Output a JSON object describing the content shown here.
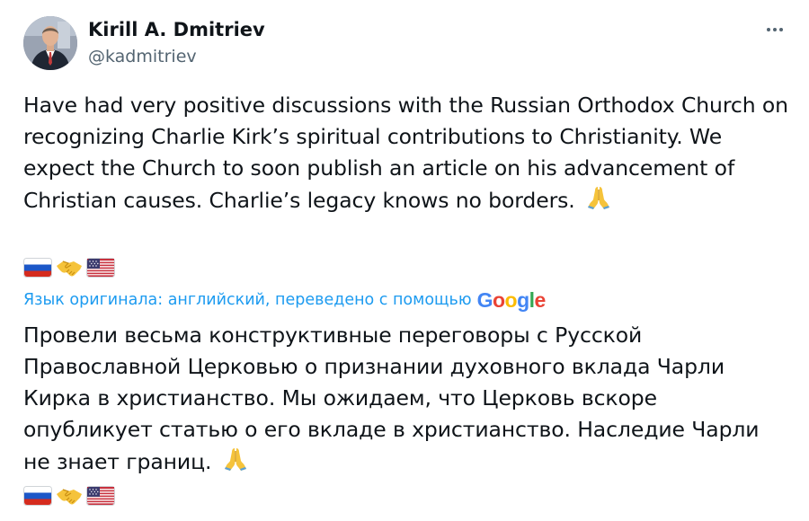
{
  "author": {
    "name": "Kirill A. Dmitriev",
    "handle": "@kadmitriev"
  },
  "tweet": {
    "text": "Have had very positive discussions with the Russian Orthodox Church on recognizing Charlie Kirk’s spiritual contributions to Christianity. We expect the Church to soon publish an article on his advancement of Christian causes. Charlie’s legacy knows no borders.",
    "trailing_emoji_icon": "folded-hands-icon",
    "flag_icons": [
      "russia-flag-icon",
      "handshake-icon",
      "usa-flag-icon"
    ]
  },
  "translation": {
    "note": "Язык оригинала: английский, переведено с помощью",
    "provider": {
      "letters": [
        "G",
        "o",
        "o",
        "g",
        "l",
        "e"
      ]
    },
    "text": "Провели весьма конструктивные переговоры с Русской Православной Церковью о признании духовного вклада Чарли Кирка в христианство. Мы ожидаем, что Церковь вскоре опубликует статью о его вкладе в христианство. Наследие Чарли не знает границ."
  },
  "colors": {
    "link_blue": "#1d9bf0",
    "text": "#0f1419",
    "secondary": "#536471"
  }
}
